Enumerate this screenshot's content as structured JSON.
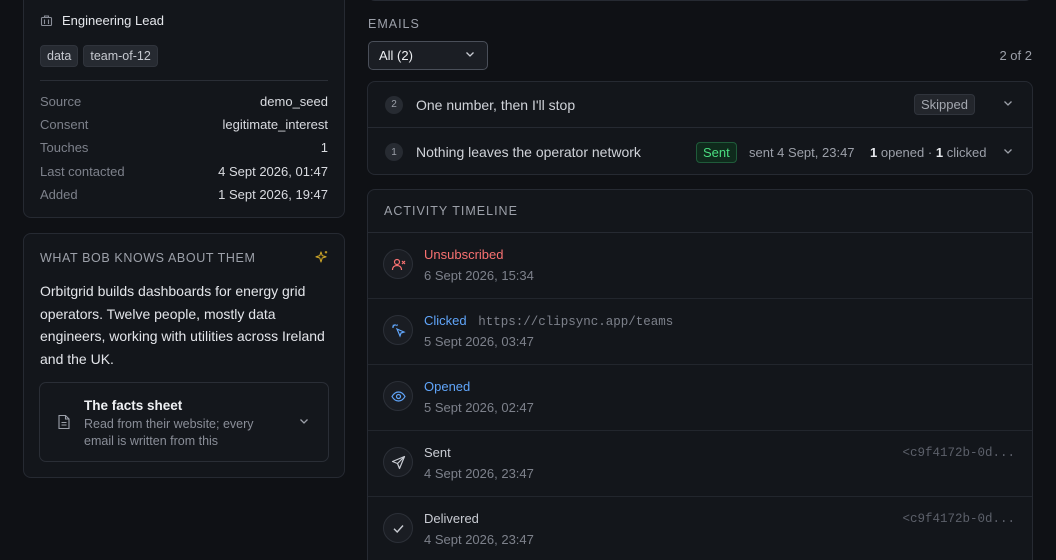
{
  "profile": {
    "role": "Engineering Lead",
    "tags": [
      "data",
      "team-of-12"
    ],
    "fields": [
      {
        "key": "Source",
        "value": "demo_seed"
      },
      {
        "key": "Consent",
        "value": "legitimate_interest"
      },
      {
        "key": "Touches",
        "value": "1"
      },
      {
        "key": "Last contacted",
        "value": "4 Sept 2026, 01:47"
      },
      {
        "key": "Added",
        "value": "1 Sept 2026, 19:47"
      }
    ]
  },
  "knows": {
    "title": "WHAT BOB KNOWS ABOUT THEM",
    "body": "Orbitgrid builds dashboards for energy grid operators. Twelve people, mostly data engineers, working with utilities across Ireland and the UK.",
    "facts": {
      "title": "The facts sheet",
      "subtitle": "Read from their website; every email is written from this"
    }
  },
  "emails": {
    "label": "EMAILS",
    "filter_value": "All (2)",
    "count": "2 of 2",
    "items": [
      {
        "num": "2",
        "subject": "One number, then I'll stop",
        "status": "Skipped"
      },
      {
        "num": "1",
        "subject": "Nothing leaves the operator network",
        "status": "Sent",
        "sent_at": "sent 4 Sept, 23:47",
        "opened": "1",
        "opened_label": "opened",
        "sep": "·",
        "clicked": "1",
        "clicked_label": "clicked"
      }
    ]
  },
  "timeline": {
    "title": "ACTIVITY TIMELINE",
    "items": [
      {
        "event": "Unsubscribed",
        "time": "6 Sept 2026, 15:34",
        "color": "#f87171",
        "icon": "user-x-icon"
      },
      {
        "event": "Clicked",
        "url": "https://clipsync.app/teams",
        "time": "5 Sept 2026, 03:47",
        "color": "#60a5fa",
        "icon": "cursor-click-icon"
      },
      {
        "event": "Opened",
        "time": "5 Sept 2026, 02:47",
        "color": "#60a5fa",
        "icon": "eye-icon"
      },
      {
        "event": "Sent",
        "time": "4 Sept 2026, 23:47",
        "msgid": "<c9f4172b-0d...",
        "color": "#c9ccd3",
        "icon": "send-icon"
      },
      {
        "event": "Delivered",
        "time": "4 Sept 2026, 23:47",
        "msgid": "<c9f4172b-0d...",
        "color": "#c9ccd3",
        "icon": "check-icon"
      }
    ]
  },
  "colors": {
    "background": "#0f1115",
    "card": "#13161b",
    "sent_green": "#4ade80",
    "unsub_red": "#f87171",
    "link_blue": "#60a5fa",
    "sparkle_gold": "#c9a227"
  }
}
